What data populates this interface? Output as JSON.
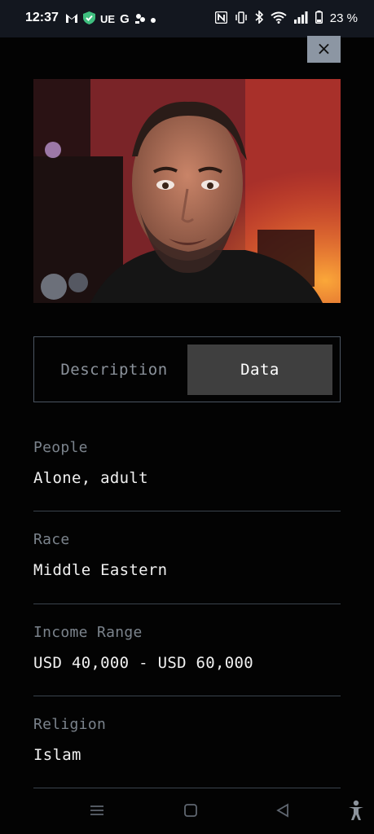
{
  "status_bar": {
    "time": "12:37",
    "left_icons": [
      "gmail-icon",
      "shield-check-icon",
      "ue-text-icon",
      "google-icon",
      "app-icon",
      "dot-icon"
    ],
    "ue_label": "UE",
    "right_icons": [
      "nfc-icon",
      "vibrate-icon",
      "bluetooth-icon",
      "wifi-icon",
      "signal-icon",
      "battery-icon"
    ],
    "battery_percent": "23 %"
  },
  "close_button": {
    "icon": "close-icon",
    "label": "×"
  },
  "photo": {
    "subject": "portrait of man in dark jacket",
    "icon": "photo"
  },
  "tabs": [
    {
      "label": "Description",
      "active": false
    },
    {
      "label": "Data",
      "active": true
    }
  ],
  "fields": [
    {
      "label": "People",
      "value": "Alone, adult"
    },
    {
      "label": "Race",
      "value": "Middle Eastern"
    },
    {
      "label": "Income Range",
      "value": "USD 40,000 - USD 60,000"
    },
    {
      "label": "Religion",
      "value": "Islam"
    }
  ],
  "nav_bar": {
    "items": [
      "menu-icon",
      "home-square-icon",
      "back-triangle-icon",
      "accessibility-icon"
    ]
  },
  "colors": {
    "background": "#030303",
    "status_bar": "#13171f",
    "close_button": "#8c96a3",
    "active_tab": "#3f3f3f",
    "label_text": "#7b838c",
    "divider": "#3a434d"
  }
}
